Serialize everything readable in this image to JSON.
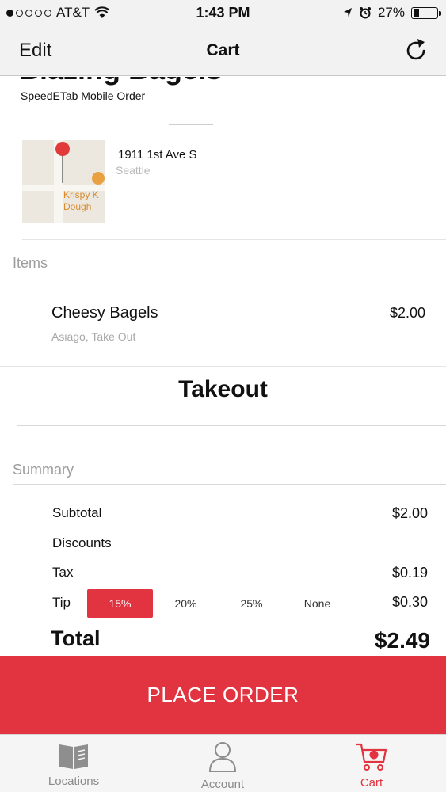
{
  "status_bar": {
    "carrier": "AT&T",
    "time": "1:43 PM",
    "battery": "27%",
    "battery_level": 0.27,
    "signal_bars": 1
  },
  "nav": {
    "edit": "Edit",
    "title": "Cart",
    "refresh_icon": "refresh-icon"
  },
  "store": {
    "name": "Blazing Bagels",
    "subtitle": "SpeedETab Mobile Order",
    "street": "1911 1st Ave S",
    "city": "Seattle",
    "map_label_line1": "Krispy K",
    "map_label_line2": "Dough"
  },
  "items": {
    "header": "Items",
    "list": [
      {
        "name": "Cheesy Bagels",
        "modifiers": "Asiago, Take Out",
        "price": "$2.00"
      }
    ]
  },
  "order_type": "Takeout",
  "summary": {
    "header": "Summary",
    "subtotal_label": "Subtotal",
    "subtotal": "$2.00",
    "discounts_label": "Discounts",
    "tax_label": "Tax",
    "tax": "$0.19",
    "tip_label": "Tip",
    "tip_options": [
      "15%",
      "20%",
      "25%",
      "None"
    ],
    "tip_selected": "15%",
    "tip": "$0.30",
    "total_label": "Total",
    "total": "$2.49"
  },
  "place_order": "PLACE ORDER",
  "tabs": [
    {
      "label": "Locations",
      "icon": "book-icon"
    },
    {
      "label": "Account",
      "icon": "person-icon"
    },
    {
      "label": "Cart",
      "icon": "cart-icon",
      "active": true
    }
  ],
  "colors": {
    "accent": "#e23440",
    "nav_background": "#f2f2f2",
    "muted_text": "#9c9c9c"
  }
}
